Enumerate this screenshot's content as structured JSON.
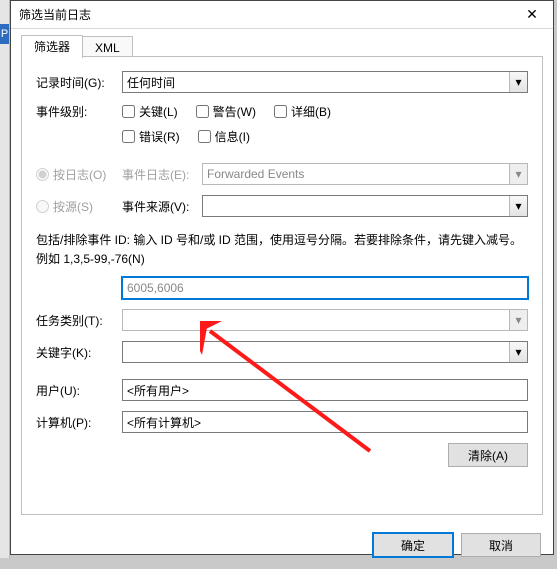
{
  "window": {
    "title": "筛选当前日志",
    "close": "✕"
  },
  "tabs": {
    "filter": "筛选器",
    "xml": "XML"
  },
  "labels": {
    "logged": "记录时间(G):",
    "level": "事件级别:",
    "byLog": "按日志(O)",
    "bySource": "按源(S)",
    "eventLogs": "事件日志(E):",
    "eventSources": "事件来源(V):",
    "note": "包括/排除事件 ID: 输入 ID 号和/或 ID 范围，使用逗号分隔。若要排除条件，请先键入减号。例如 1,3,5-99,-76(N)",
    "taskCat": "任务类别(T):",
    "keywords": "关键字(K):",
    "user": "用户(U):",
    "computer": "计算机(P):"
  },
  "values": {
    "logged": "任何时间",
    "eventLogs": "Forwarded Events",
    "eventSources": "",
    "eventId": "6005,6006",
    "taskCat": "",
    "keywords": "",
    "user": "<所有用户>",
    "computer": "<所有计算机>"
  },
  "checks": {
    "critical": "关键(L)",
    "warning": "警告(W)",
    "verbose": "详细(B)",
    "error": "错误(R)",
    "info": "信息(I)"
  },
  "buttons": {
    "clear": "清除(A)",
    "ok": "确定",
    "cancel": "取消"
  },
  "icons": {
    "chevron": "▾"
  }
}
